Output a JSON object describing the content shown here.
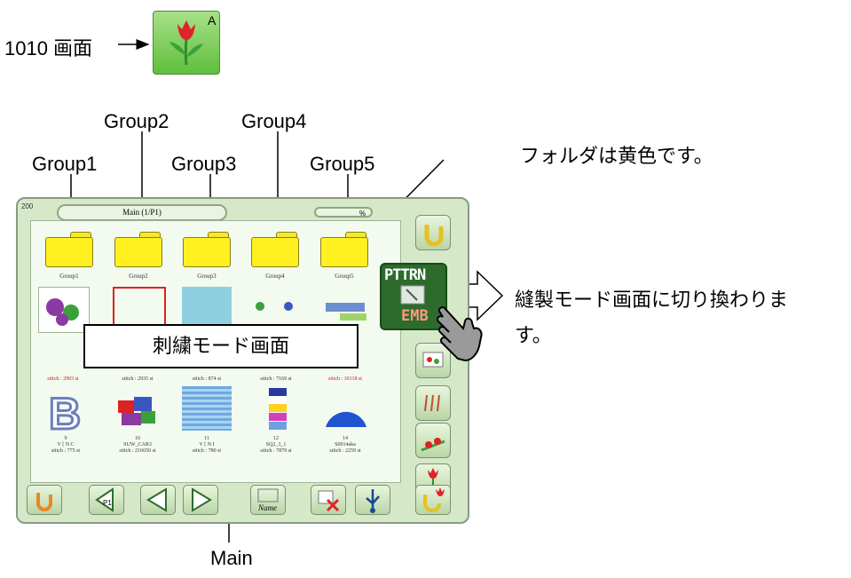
{
  "screen_ref": {
    "label": "1010 画面",
    "badge": "A"
  },
  "group_labels": [
    "Group1",
    "Group2",
    "Group3",
    "Group4",
    "Group5"
  ],
  "callouts": {
    "folder_note": "フォルダは黄色です。",
    "switch_note": "縫製モード画面に切り換わりま",
    "switch_note_2": "す。",
    "overlay": "刺繍モード画面",
    "main": "Main"
  },
  "panel": {
    "page_no": "200",
    "title": "Main (1/P1)",
    "percent": "%",
    "folders": [
      "Group1",
      "Group2",
      "Group3",
      "Group4",
      "Group5"
    ],
    "row2_captions": [
      "stitch : 2903 st",
      "stitch : 2935 st",
      "stitch : 874 st",
      "stitch : 7169 st",
      "stitch : 10118 st"
    ],
    "row3_captions": [
      {
        "no": "9",
        "name": "V [ N C",
        "stitch": "stitch : 775 st"
      },
      {
        "no": "10",
        "name": "SUW_CAR3",
        "stitch": "stitch : 216650 st"
      },
      {
        "no": "11",
        "name": "V [ N I",
        "stitch": "stitch : 780 st"
      },
      {
        "no": "12",
        "name": "SQ2_3_1",
        "stitch": "stitch : 7879 st"
      },
      {
        "no": "14",
        "name": "S0014aka",
        "stitch": "stitch : 2259 st"
      }
    ],
    "mode_button": {
      "top": "PTTRN",
      "bottom": "EMB"
    },
    "bottom_buttons": [
      "P1",
      "Name"
    ],
    "colors": {
      "folder": "#fff020",
      "panel": "#d5e9c9",
      "mode": "#2d6b2d"
    }
  }
}
